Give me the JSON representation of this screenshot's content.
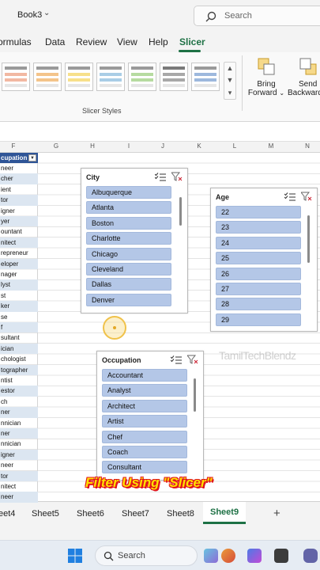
{
  "window": {
    "book_title": "Book3",
    "search_placeholder": "Search"
  },
  "ribbon": {
    "tabs": [
      "ormulas",
      "Data",
      "Review",
      "View",
      "Help",
      "Slicer"
    ],
    "group_label": "Slicer Styles",
    "bring_forward": [
      "Bring",
      "Forward"
    ],
    "send_backward": [
      "Send",
      "Backward"
    ]
  },
  "columns": [
    "F",
    "G",
    "H",
    "I",
    "J",
    "K",
    "L",
    "M",
    "N"
  ],
  "table": {
    "header": "cupation",
    "cells": [
      "neer",
      "cher",
      "ient",
      "tor",
      "igner",
      "yer",
      "ountant",
      "nitect",
      "repreneur",
      "eloper",
      "nager",
      "lyst",
      "st",
      "ker",
      "se",
      "f",
      "sultant",
      "ician",
      "chologist",
      "tographer",
      "ntist",
      "estor",
      "ch",
      "ner",
      "nnician",
      "ner",
      "nnician",
      "igner",
      "neer",
      "tor",
      "nitect",
      "neer"
    ]
  },
  "slicers": {
    "city": {
      "title": "City",
      "items": [
        "Albuquerque",
        "Atlanta",
        "Boston",
        "Charlotte",
        "Chicago",
        "Cleveland",
        "Dallas",
        "Denver"
      ]
    },
    "age": {
      "title": "Age",
      "items": [
        "22",
        "23",
        "24",
        "25",
        "26",
        "27",
        "28",
        "29"
      ]
    },
    "occupation": {
      "title": "Occupation",
      "items": [
        "Accountant",
        "Analyst",
        "Architect",
        "Artist",
        "Chef",
        "Coach",
        "Consultant"
      ]
    }
  },
  "watermark": "TamilTechBlendz",
  "caption": "Filter Using \"Slicer\"",
  "sheets": [
    "eet4",
    "Sheet5",
    "Sheet6",
    "Sheet7",
    "Sheet8",
    "Sheet9"
  ],
  "active_sheet": "Sheet9",
  "add_sheet_label": "+",
  "taskbar": {
    "search_label": "Search"
  },
  "colors": {
    "accent": "#1e7145",
    "slicer_item": "#b4c7e7",
    "table_header": "#2f5597",
    "caption_fill": "#ffe000",
    "caption_outline": "#e0151b"
  }
}
